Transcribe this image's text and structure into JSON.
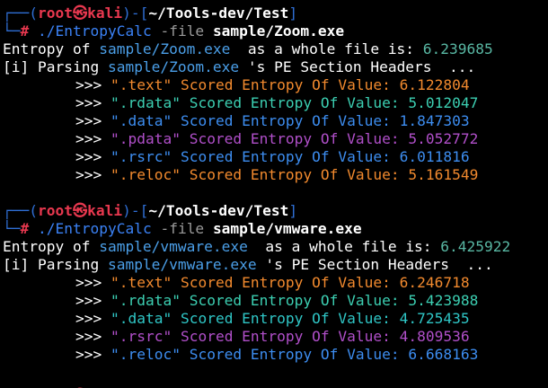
{
  "prompt": {
    "box_top": "┌──(",
    "box_mid": ")-[",
    "box_end": "]",
    "box_bottom": "└─",
    "user": "root",
    "skull": "㉿",
    "host": "kali",
    "path": "~/Tools-dev/Test",
    "hash": "#"
  },
  "sessions": [
    {
      "command": "./EntropyCalc",
      "flag": "-file",
      "file_arg": "sample/Zoom.exe",
      "whole_prefix": "Entropy of ",
      "whole_file": "sample/Zoom.exe",
      "whole_mid": "  as a whole file is: ",
      "whole_value": "6.239685",
      "parse_prefix": "[i] Parsing ",
      "parse_file": "sample/Zoom.exe",
      "parse_suffix": " 's PE Section Headers  ...",
      "sections": [
        {
          "name": "\".text\"",
          "label": " Scored Entropy Of Value: ",
          "value": "6.122804",
          "color": "orange"
        },
        {
          "name": "\".rdata\"",
          "label": " Scored Entropy Of Value: ",
          "value": "5.012047",
          "color": "teal"
        },
        {
          "name": "\".data\"",
          "label": " Scored Entropy Of Value: ",
          "value": "1.847303",
          "color": "blue"
        },
        {
          "name": "\".pdata\"",
          "label": " Scored Entropy Of Value: ",
          "value": "5.052772",
          "color": "purple"
        },
        {
          "name": "\".rsrc\"",
          "label": " Scored Entropy Of Value: ",
          "value": "6.011816",
          "color": "blue"
        },
        {
          "name": "\".reloc\"",
          "label": " Scored Entropy Of Value: ",
          "value": "5.161549",
          "color": "orange"
        }
      ]
    },
    {
      "command": "./EntropyCalc",
      "flag": "-file",
      "file_arg": "sample/vmware.exe",
      "whole_prefix": "Entropy of ",
      "whole_file": "sample/vmware.exe",
      "whole_mid": "  as a whole file is: ",
      "whole_value": "6.425922",
      "parse_prefix": "[i] Parsing ",
      "parse_file": "sample/vmware.exe",
      "parse_suffix": " 's PE Section Headers  ...",
      "sections": [
        {
          "name": "\".text\"",
          "label": " Scored Entropy Of Value: ",
          "value": "6.246718",
          "color": "orange"
        },
        {
          "name": "\".rdata\"",
          "label": " Scored Entropy Of Value: ",
          "value": "5.423988",
          "color": "teal"
        },
        {
          "name": "\".data\"",
          "label": " Scored Entropy Of Value: ",
          "value": "4.725435",
          "color": "teal"
        },
        {
          "name": "\".rsrc\"",
          "label": " Scored Entropy Of Value: ",
          "value": "4.809536",
          "color": "purple"
        },
        {
          "name": "\".reloc\"",
          "label": " Scored Entropy Of Value: ",
          "value": "6.668163",
          "color": "blue"
        }
      ]
    }
  ],
  "section_marker": ">>> ",
  "colors": {
    "orange": "#f28a2e",
    "teal": "#3ccfb2",
    "blue": "#3d8df0",
    "purple": "#b04fc9",
    "prompt_box": "#2f6fd6",
    "prompt_user": "#e8384f",
    "filename": "#4b9fe8",
    "whole_value": "#59b8a4"
  }
}
